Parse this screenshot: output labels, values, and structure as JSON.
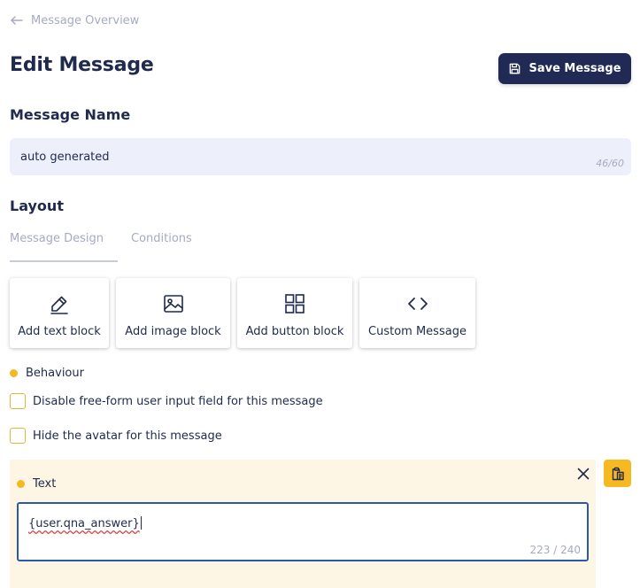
{
  "nav": {
    "back_label": "Message Overview"
  },
  "header": {
    "title": "Edit Message",
    "save_label": "Save Message"
  },
  "message_name": {
    "heading": "Message Name",
    "value": "auto generated",
    "counter": "46/60"
  },
  "layout": {
    "heading": "Layout",
    "tabs": [
      {
        "label": "Message Design",
        "active": true
      },
      {
        "label": "Conditions",
        "active": false
      }
    ],
    "blocks": [
      {
        "label": "Add text block",
        "icon": "pencil-icon"
      },
      {
        "label": "Add image block",
        "icon": "image-icon"
      },
      {
        "label": "Add button block",
        "icon": "grid-icon"
      },
      {
        "label": "Custom Message",
        "icon": "code-icon"
      }
    ]
  },
  "behaviour": {
    "label": "Behaviour",
    "options": [
      {
        "label": "Disable free-form user input field for this message",
        "checked": false
      },
      {
        "label": "Hide the avatar for this message",
        "checked": false
      }
    ]
  },
  "text_block": {
    "label": "Text",
    "value": "{user.qna_answer}",
    "counter": "223 / 240"
  },
  "colors": {
    "primary": "#202a55",
    "accent": "#f3b922",
    "panel_bg": "#fef6e4",
    "input_bg": "#edf0fb",
    "focus_border": "#2a5aa6"
  }
}
